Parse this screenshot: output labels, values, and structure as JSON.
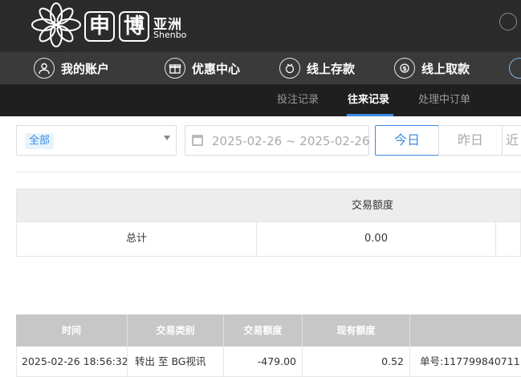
{
  "brand": {
    "box1": "申",
    "box2": "博",
    "cn": "亚洲",
    "en": "Shenbo"
  },
  "nav": [
    {
      "label": "我的账户",
      "icon": "user-icon"
    },
    {
      "label": "优惠中心",
      "icon": "gift-icon"
    },
    {
      "label": "线上存款",
      "icon": "deposit-icon"
    },
    {
      "label": "线上取款",
      "icon": "withdraw-icon"
    }
  ],
  "subnav": [
    {
      "label": "投注记录",
      "active": false
    },
    {
      "label": "往来记录",
      "active": true
    },
    {
      "label": "处理中订单",
      "active": false
    }
  ],
  "filters": {
    "type_selected": "全部",
    "date_range": "2025-02-26 ~ 2025-02-26",
    "btn_today": "今日",
    "btn_yesterday": "昨日",
    "btn_more": "近"
  },
  "summary": {
    "header": "交易额度",
    "row_label": "总计",
    "row_value": "0.00"
  },
  "detail": {
    "columns": [
      "时间",
      "交易类别",
      "交易额度",
      "现有额度",
      ""
    ],
    "rows": [
      {
        "time": "2025-02-26 18:56:32",
        "type": "转出 至 BG视讯",
        "amount": "-479.00",
        "balance": "0.52",
        "note": "单号:117799840711"
      }
    ]
  },
  "colors": {
    "accent": "#3b8be3",
    "header_bg": "#2b2b2b",
    "nav_bg": "#3a3a3a",
    "subnav_bg": "#1f1f1f"
  }
}
